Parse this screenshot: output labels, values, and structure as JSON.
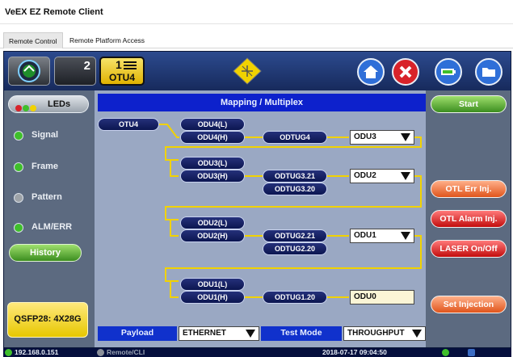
{
  "window": {
    "title": "VeEX EZ Remote Client"
  },
  "tabs": [
    {
      "label": "Remote Control"
    },
    {
      "label": "Remote Platform Access"
    }
  ],
  "topbar": {
    "slot2_number": "2",
    "slot1_number": "1",
    "slot1_label": "OTU4"
  },
  "leds": {
    "header": "LEDs",
    "items": [
      {
        "label": "Signal",
        "color": "#3fbf2b"
      },
      {
        "label": "Frame",
        "color": "#3fbf2b"
      },
      {
        "label": "Pattern",
        "color": "#9ea3a8"
      },
      {
        "label": "ALM/ERR",
        "color": "#3fbf2b"
      }
    ],
    "history_label": "History",
    "module_label": "QSFP28: 4X28G"
  },
  "mapping": {
    "title": "Mapping / Multiplex",
    "otu4": "OTU4",
    "odu4l": "ODU4(L)",
    "odu4h": "ODU4(H)",
    "odtug4": "ODTUG4",
    "sel_odu3": "ODU3",
    "odu3l": "ODU3(L)",
    "odu3h": "ODU3(H)",
    "odtug321": "ODTUG3.21",
    "odtug320": "ODTUG3.20",
    "sel_odu2": "ODU2",
    "odu2l": "ODU2(L)",
    "odu2h": "ODU2(H)",
    "odtug221": "ODTUG2.21",
    "odtug220": "ODTUG2.20",
    "sel_odu1": "ODU1",
    "odu1l": "ODU1(L)",
    "odu1h": "ODU1(H)",
    "odtug120": "ODTUG1.20",
    "odu0": "ODU0"
  },
  "bottom": {
    "payload_label": "Payload",
    "payload_value": "ETHERNET",
    "testmode_label": "Test Mode",
    "testmode_value": "THROUGHPUT"
  },
  "right": {
    "start": "Start",
    "otl_err": "OTL Err Inj.",
    "otl_alarm": "OTL Alarm Inj.",
    "laser": "LASER On/Off",
    "set_injection": "Set Injection"
  },
  "status": {
    "ip": "192.168.0.151",
    "remote": "Remote/CLI",
    "datetime": "2018-07-17  09:04:50"
  }
}
